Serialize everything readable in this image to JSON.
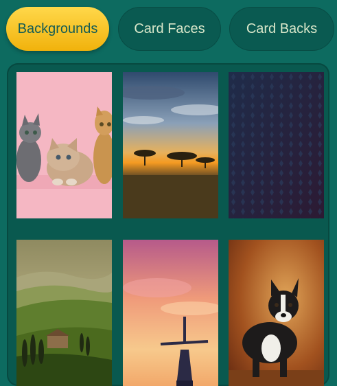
{
  "tabs": [
    {
      "label": "Backgrounds",
      "active": true
    },
    {
      "label": "Card Faces",
      "active": false
    },
    {
      "label": "Card Backs",
      "active": false
    }
  ],
  "backgrounds": [
    {
      "subject": "kittens-on-pink"
    },
    {
      "subject": "savanna-sunset"
    },
    {
      "subject": "dark-navy-pattern"
    },
    {
      "subject": "tuscany-hills"
    },
    {
      "subject": "windmill-sunset"
    },
    {
      "subject": "boston-terrier"
    }
  ],
  "colors": {
    "page_bg": "#0d6b60",
    "panel_bg": "#09594f",
    "active_tab": "#f5c21b",
    "inactive_tab": "#0a5a51",
    "inactive_text": "#d8e6c9"
  }
}
